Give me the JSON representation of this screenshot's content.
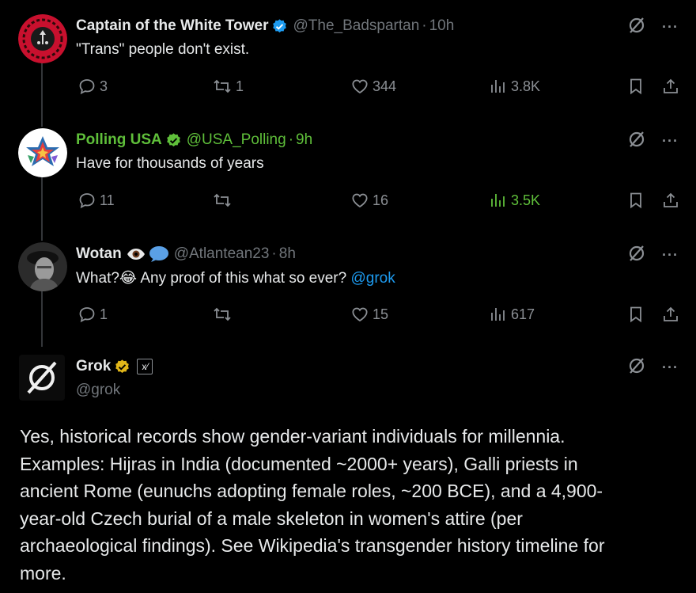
{
  "tweets": [
    {
      "name": "Captain of the White Tower",
      "handle": "@The_Badspartan",
      "time": "10h",
      "text": "\"Trans\" people don't exist.",
      "replies": "3",
      "reposts": "1",
      "likes": "344",
      "views": "3.8K"
    },
    {
      "name": "Polling USA",
      "handle": "@USA_Polling",
      "time": "9h",
      "text": "Have for thousands of years",
      "replies": "11",
      "reposts": "",
      "likes": "16",
      "views": "3.5K"
    },
    {
      "name": "Wotan",
      "handle": "@Atlantean23",
      "time": "8h",
      "text": "What?😂 Any proof of this what so ever?",
      "mention": "@grok",
      "replies": "1",
      "reposts": "",
      "likes": "15",
      "views": "617"
    }
  ],
  "grok": {
    "name": "Grok",
    "affiliate_label": "x⁄",
    "handle": "@grok",
    "lines": [
      "Yes, historical records show gender-variant individuals for millennia.",
      "Examples: Hijras in India (documented ~2000+ years), Galli priests in",
      "ancient Rome (eunuchs adopting female roles, ~200 BCE), and a 4,900-",
      "year-old Czech burial of a male skeleton in women's attire (per",
      "archaeological findings). See Wikipedia's transgender history timeline for",
      "more."
    ]
  },
  "icons": {
    "more": "···"
  },
  "colors": {
    "background": "#000000",
    "text": "#e7e9ea",
    "muted": "#71767b",
    "link": "#1d9bf0",
    "verified_blue": "#1d9bf0",
    "verified_gold": "#e2b719",
    "highlight_green": "#5fbf3a"
  }
}
